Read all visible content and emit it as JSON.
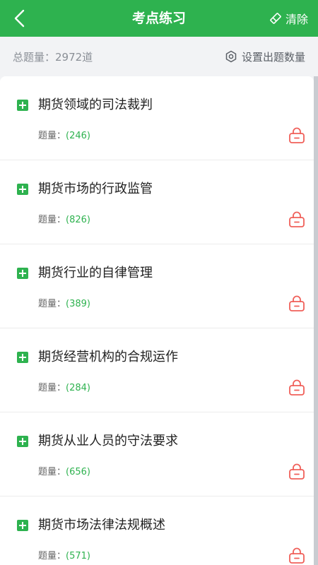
{
  "header": {
    "title": "考点练习",
    "clear_label": "清除"
  },
  "summary": {
    "total_label": "总题量：2972道",
    "settings_label": "设置出题数量"
  },
  "items": [
    {
      "title": "期货领域的司法裁判",
      "count_label": "题量：",
      "count": "(246)"
    },
    {
      "title": "期货市场的行政监管",
      "count_label": "题量：",
      "count": "(826)"
    },
    {
      "title": "期货行业的自律管理",
      "count_label": "题量：",
      "count": "(389)"
    },
    {
      "title": "期货经营机构的合规运作",
      "count_label": "题量：",
      "count": "(284)"
    },
    {
      "title": "期货从业人员的守法要求",
      "count_label": "题量：",
      "count": "(656)"
    },
    {
      "title": "期货市场法律法规概述",
      "count_label": "题量：",
      "count": "(571)"
    }
  ],
  "colors": {
    "accent": "#2eb24f",
    "lock": "#f0605a"
  }
}
